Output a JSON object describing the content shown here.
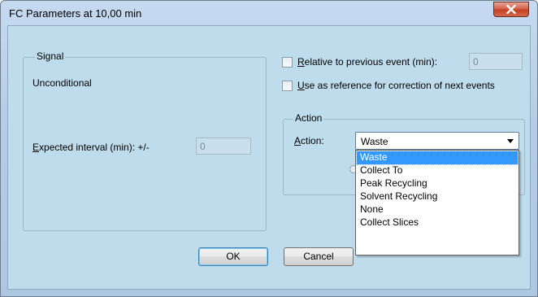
{
  "window": {
    "title": "FC Parameters at 10,00 min",
    "close_label": "X"
  },
  "signal": {
    "group_label": "Signal",
    "condition_text": "Unconditional",
    "expected_interval_label_first": "E",
    "expected_interval_label_rest": "xpected interval (min): +/-",
    "expected_interval_value": "0"
  },
  "relative": {
    "label_first": "R",
    "label_rest": "elative to previous event (min):",
    "checked": false,
    "value": "0"
  },
  "reference": {
    "label_first": "U",
    "label_rest": "se as reference for correction of next events",
    "checked": false
  },
  "action": {
    "group_label": "Action",
    "label_first": "A",
    "label_rest": "ction:",
    "selected_value": "Waste",
    "options": [
      "Waste",
      "Collect To",
      "Peak Recycling",
      "Solvent Recycling",
      "None",
      "Collect Slices"
    ]
  },
  "buttons": {
    "ok_label": "OK",
    "cancel_label": "Cancel"
  }
}
